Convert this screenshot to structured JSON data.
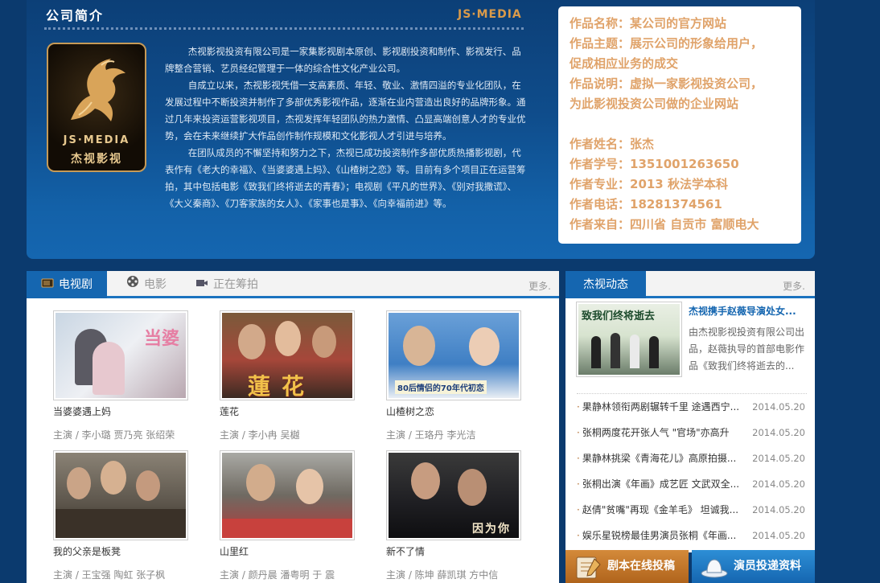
{
  "intro": {
    "title": "公司简介",
    "brand": "JS·MEDIA",
    "logo_en": "JS·MEDIA",
    "logo_cn": "杰视影视",
    "paragraphs": [
      "杰视影视投资有限公司是一家集影视剧本原创、影视剧投资和制作、影视发行、品牌整合营销、艺员经纪管理于一体的综合性文化产业公司。",
      "自成立以来，杰视影视凭借一支高素质、年轻、敬业、激情四溢的专业化团队，在发展过程中不断投资并制作了多部优秀影视作品，逐渐在业内营造出良好的品牌形象。通过几年来投资运营影视项目，杰视发挥年轻团队的热力激情、凸显高端创意人才的专业优势，会在未来继续扩大作品创作制作规模和文化影视人才引进与培养。",
      "在团队成员的不懈坚持和努力之下，杰视已成功投资制作多部优质热播影视剧，代表作有《老大的幸福》、《当婆婆遇上妈》、《山楂树之恋》等。目前有多个项目正在运营筹拍，其中包括电影《致我们终将逝去的青春》；电视剧《平凡的世界》、《别对我撒谎》、《大义秦商》、《刀客家族的女人》、《家事也是事》、《向幸福前进》等。"
    ]
  },
  "info_card": {
    "lines_top": [
      "作品名称：某公司的官方网站",
      "作品主题：展示公司的形象给用户，",
      "促成相应业务的成交",
      "作品说明：虚拟一家影视投资公司，",
      "为此影视投资公司做的企业网站"
    ],
    "lines_bottom": [
      "作者姓名：张杰",
      "作者学号：1351001263650",
      "作者专业：2013 秋法学本科",
      "作者电话：18281374561",
      "作者来自：四川省 自贡市 富顺电大"
    ]
  },
  "tabs": {
    "items": [
      "电视剧",
      "电影",
      "正在筹拍"
    ],
    "more": "更多.",
    "cards": [
      {
        "title": "当婆婆遇上妈",
        "cast": "主演 / 李小璐 贾乃亮 张绍荣",
        "caption": "当婆"
      },
      {
        "title": "莲花",
        "cast": "主演 / 李小冉 吴樾",
        "caption": "蓮花"
      },
      {
        "title": "山楂树之恋",
        "cast": "主演 / 王珞丹 李光洁",
        "caption": "80后情侣的70年代初恋"
      },
      {
        "title": "我的父亲是板凳",
        "cast": "主演 / 王宝强 陶虹 张子枫",
        "caption": ""
      },
      {
        "title": "山里红",
        "cast": "主演 / 颜丹晨 潘粤明 于 震",
        "caption": ""
      },
      {
        "title": "新不了情",
        "cast": "主演 / 陈坤 薛凯琪 方中信",
        "caption": "因为你"
      }
    ]
  },
  "news": {
    "tab": "杰视动态",
    "more": "更多.",
    "featured": {
      "image_caption": "致我们终将逝去",
      "title": "杰视携手赵薇导演处女...",
      "desc": "由杰视影视投资有限公司出品，赵薇执导的首部电影作品《致我们终将逝去的..."
    },
    "items": [
      {
        "title": "果静林领衔两剧辗转千里 途遇西宁...",
        "date": "2014.05.20"
      },
      {
        "title": "张桐两度花开张人气 \"官场\"亦高升",
        "date": "2014.05.20"
      },
      {
        "title": "果静林挑梁《青海花儿》高原拍摄...",
        "date": "2014.05.20"
      },
      {
        "title": "张桐出演《年画》成艺匠 文武双全...",
        "date": "2014.05.20"
      },
      {
        "title": "赵倩\"贫嘴\"再现《金羊毛》 坦诚我...",
        "date": "2014.05.20"
      },
      {
        "title": "娱乐星锐榜最佳男演员张桐《年画...",
        "date": "2014.05.20"
      }
    ]
  },
  "buttons": {
    "script": "剧本在线投稿",
    "actor": "演员投递资料"
  },
  "colors": {
    "page_bg": "#0b3a6e",
    "accent_blue": "#1566b0",
    "accent_gold": "#e0a36a"
  }
}
